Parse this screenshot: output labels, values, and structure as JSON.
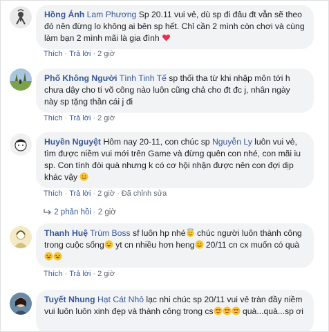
{
  "comments": [
    {
      "author": "Hồng Ánh",
      "tagged": "Lam Phương",
      "text": " Sp 20.11 vui vẻ, dù sp đi đâu đt vẫn sẽ theo đó nên đừng lo không ai bên sp hết. Chỉ cần 2 mình còn chơi và cùng làm bạn 2 mình mãi là gia đình ",
      "emoji": "red-heart",
      "actions": {
        "like": "Thích",
        "reply": "Trả lời",
        "time": "2 giờ"
      }
    },
    {
      "author": "Phố Không Người",
      "tagged": "Tình Tinh Tế",
      "text": " sp thối tha từ khi nhập môn tới h chưa dậy cho tí võ công nào luôn cũng chả cho đt đc j, nhân ngày này sp tặng thần cái j đi",
      "actions": {
        "like": "Thích",
        "reply": "Trả lời",
        "time": "2 giờ"
      }
    },
    {
      "author": "Huyền Nguyệt",
      "text_before": " Hôm nay 20-11, con chúc sp ",
      "tagged": "Nguyễn Ly",
      "text_after": " luôn vui vẻ, tìm được niềm vui mới trên Game và đừng quên con nhé, con mãi iu sp. Con tính đòi quà nhưng k có cơ hội nhận được nên con đợi dịp khác vậy ",
      "emoji": "smiling-face",
      "actions": {
        "like": "Thích",
        "reply": "Trả lời",
        "time": "2 giờ",
        "edited": "Đã chỉnh sửa"
      },
      "replies": {
        "label": "2 phản hồi",
        "time": "2 giờ"
      }
    },
    {
      "author": "Thanh Huệ",
      "tagged": "Trùm Boss",
      "text_1": " sf luôn hp nhé",
      "text_2": " chúc người luôn thành công trong cuộc sống",
      "text_3": " yt cn nhiều hơn heng",
      "text_4": " 20/11 cn cx muốn có quà",
      "actions": {
        "like": "Thích",
        "reply": "Trả lời",
        "time": "2 giờ"
      }
    },
    {
      "author": "Tuyết Nhung",
      "tagged": "Hạt Cát Nhỏ",
      "text": " lạc nhi chúc sp 20/11 vui vẻ tràn đầy niềm vui luôn luôn xinh đẹp và thành công trong cs",
      "text_end": " quà...quà...sp ơi"
    }
  ],
  "colors": {
    "link": "#385898",
    "bubble": "#f2f3f5",
    "meta": "#606770"
  }
}
